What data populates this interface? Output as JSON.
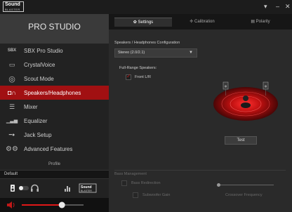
{
  "titlebar": {
    "logo_line1": "Sound",
    "logo_line2": "BLASTER",
    "dropdown_glyph": "▾",
    "minimize_glyph": "–",
    "close_glyph": "✕"
  },
  "sidebar": {
    "title": "PRO STUDIO",
    "items": [
      {
        "label": "SBX Pro Studio",
        "icon": "sbx-icon",
        "glyph": "SBX"
      },
      {
        "label": "CrystalVoice",
        "icon": "crystalvoice-icon",
        "glyph": "▭"
      },
      {
        "label": "Scout Mode",
        "icon": "crosshair-icon",
        "glyph": "◎"
      },
      {
        "label": "Speakers/Headphones",
        "icon": "speaker-headphone-icon",
        "glyph": "◘∩",
        "active": true
      },
      {
        "label": "Mixer",
        "icon": "mixer-icon",
        "glyph": "☰"
      },
      {
        "label": "Equalizer",
        "icon": "equalizer-icon",
        "glyph": "▁▃▅"
      },
      {
        "label": "Jack Setup",
        "icon": "jack-icon",
        "glyph": "━●"
      },
      {
        "label": "Advanced Features",
        "icon": "gears-icon",
        "glyph": "⚙⚙"
      }
    ],
    "profile_header": "Profile",
    "profile_value": "Default",
    "bottom_badge_line1": "Sound",
    "bottom_badge_line2": "BLASTER",
    "volume_fraction": 0.65
  },
  "main": {
    "tabs": [
      {
        "label": "Settings",
        "glyph": "✿"
      },
      {
        "label": "Calibration",
        "glyph": "✢"
      },
      {
        "label": "Polarity",
        "glyph": "▤"
      }
    ],
    "speakers_config_label": "Speakers / Headphones Configuration",
    "speakers_config_value": "Stereo (2.0/2.1)",
    "full_range_label": "Full-Range Speakers:",
    "full_range_option": "Front L/R",
    "test_label": "Test",
    "bass_mgmt_label": "Bass Management",
    "bass_redirection_label": "Bass Redirection",
    "subwoofer_gain_label": "Subwoofer Gain",
    "crossover_label": "Crossover Frequency"
  },
  "colors": {
    "accent": "#a11012",
    "accent_bright": "#e01818",
    "background": "#2a2a2a"
  }
}
